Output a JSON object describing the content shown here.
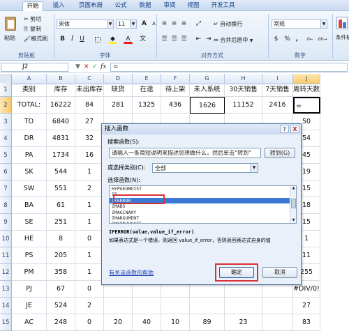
{
  "ribbon_tabs": [
    "开始",
    "插入",
    "页面布局",
    "公式",
    "数据",
    "审阅",
    "视图",
    "开发工具"
  ],
  "clipboard": {
    "paste": "粘贴",
    "cut": "剪切",
    "copy": "复制",
    "format_painter": "格式刷",
    "group": "剪贴板"
  },
  "font": {
    "name": "宋体",
    "size": "11",
    "group": "字体",
    "bold": "B",
    "italic": "I",
    "underline": "U",
    "grow": "A",
    "shrink": "A",
    "fill_color": "A",
    "font_color": "A"
  },
  "alignment": {
    "wrap": "自动换行",
    "merge": "合并后居中",
    "group": "对齐方式"
  },
  "number": {
    "format": "常规",
    "group": "数字",
    "percent": "%",
    "comma": ",",
    "currency": "$"
  },
  "styles": {
    "label": "条件格"
  },
  "formula_bar": {
    "name_box": "J2",
    "fx": "fx",
    "content": "="
  },
  "columns": [
    "A",
    "B",
    "C",
    "D",
    "E",
    "F",
    "G",
    "H",
    "I",
    "J"
  ],
  "rows": [
    "1",
    "2",
    "3",
    "4",
    "5",
    "6",
    "7",
    "8",
    "9",
    "10",
    "11",
    "12",
    "13",
    "14",
    "15"
  ],
  "table": {
    "header": [
      "类别",
      "库存",
      "未出库存",
      "缺货",
      "在途",
      "待上架",
      "未入系统",
      "30天销售",
      "7天销售",
      "周转天数"
    ],
    "total": [
      "TOTAL:",
      "16222",
      "84",
      "281",
      "1325",
      "436",
      "1626",
      "11152",
      "2416",
      "="
    ],
    "body": [
      [
        "TO",
        "6840",
        "27",
        "",
        "",
        "",
        "",
        "",
        "",
        "50"
      ],
      [
        "DR",
        "4831",
        "32",
        "",
        "",
        "",
        "",
        "",
        "",
        "54"
      ],
      [
        "PA",
        "1734",
        "16",
        "",
        "",
        "",
        "",
        "",
        "",
        "45"
      ],
      [
        "SK",
        "544",
        "1",
        "",
        "",
        "",
        "",
        "",
        "",
        "19"
      ],
      [
        "SW",
        "551",
        "2",
        "",
        "",
        "",
        "",
        "",
        "",
        "15"
      ],
      [
        "BA",
        "61",
        "1",
        "",
        "",
        "",
        "",
        "",
        "",
        "18"
      ],
      [
        "SE",
        "251",
        "1",
        "",
        "",
        "",
        "",
        "",
        "",
        "15"
      ],
      [
        "HE",
        "8",
        "0",
        "",
        "",
        "",
        "",
        "",
        "",
        "1"
      ],
      [
        "PS",
        "205",
        "1",
        "",
        "",
        "",
        "",
        "",
        "",
        "11"
      ],
      [
        "PM",
        "358",
        "1",
        "",
        "",
        "",
        "",
        "",
        "",
        "255"
      ],
      [
        "PJ",
        "67",
        "0",
        "",
        "",
        "",
        "",
        "",
        "",
        "#DIV/0!"
      ],
      [
        "JE",
        "524",
        "2",
        "",
        "",
        "",
        "",
        "",
        "",
        "27"
      ],
      [
        "AC",
        "248",
        "0",
        "20",
        "40",
        "10",
        "89",
        "23",
        "",
        "83"
      ]
    ]
  },
  "dialog": {
    "title": "插入函数",
    "search_label": "搜索函数(S):",
    "search_placeholder": "请输入一条简短说明来描述您想做什么，然后单击“转到”",
    "go_button": "转到(G)",
    "category_label": "或选择类别(C):",
    "category_value": "全部",
    "select_label": "选择函数(N):",
    "functions": [
      "HYPGEOMDIST",
      "IF",
      "IFERROR",
      "IMABS",
      "IMAGINARY",
      "IMARGUMENT",
      "IMCONJUGATE"
    ],
    "selected_index": 2,
    "syntax": "IFERROR(value,value_if_error)",
    "description": "如果表达式是一个错误，则返回 value_if_error，否则返回表达式自身的值",
    "help_link": "有关该函数的帮助",
    "ok": "确定",
    "cancel": "取消",
    "help_btn": "?",
    "close_btn": "X"
  },
  "colors": {
    "accent": "#3a78d4",
    "highlight": "#d9303a"
  }
}
